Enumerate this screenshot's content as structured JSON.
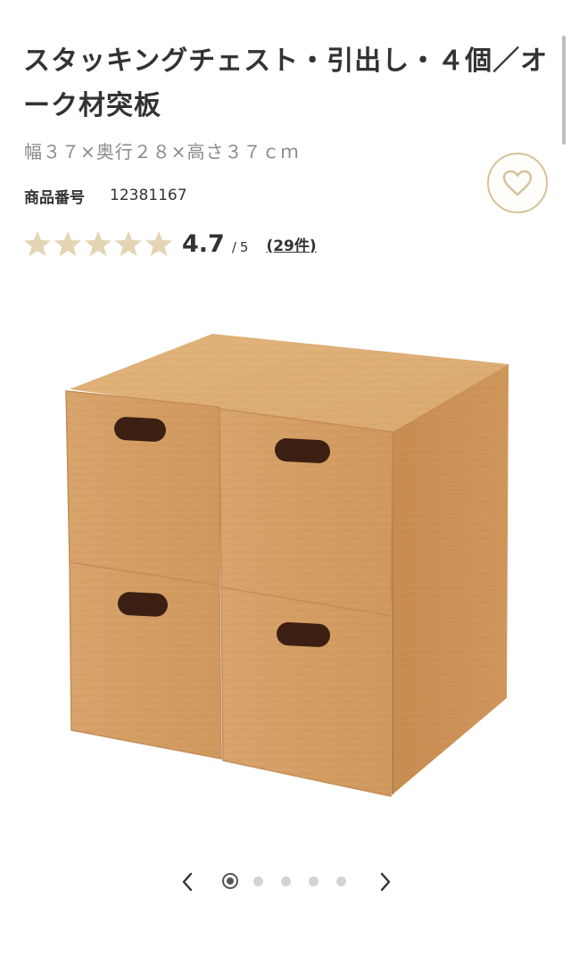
{
  "product": {
    "title": "スタッキングチェスト・引出し・４個／オーク材突板",
    "dimensions": "幅３７×奥行２８×高さ３７ｃｍ",
    "number_label": "商品番号",
    "number_value": "12381167"
  },
  "rating": {
    "stars_filled": 5,
    "value": "4.7",
    "separator": "/",
    "max": "5",
    "reviews_link": "(29件)",
    "star_color": "#e3d4b4"
  },
  "favorite": {
    "icon": "heart-icon",
    "color": "#d6c29a"
  },
  "carousel": {
    "slides": 5,
    "active_index": 0,
    "prev_icon": "chevron-left-icon",
    "next_icon": "chevron-right-icon"
  },
  "colors": {
    "text": "#333333",
    "muted": "#8a8a8a",
    "accent": "#d6c29a"
  }
}
